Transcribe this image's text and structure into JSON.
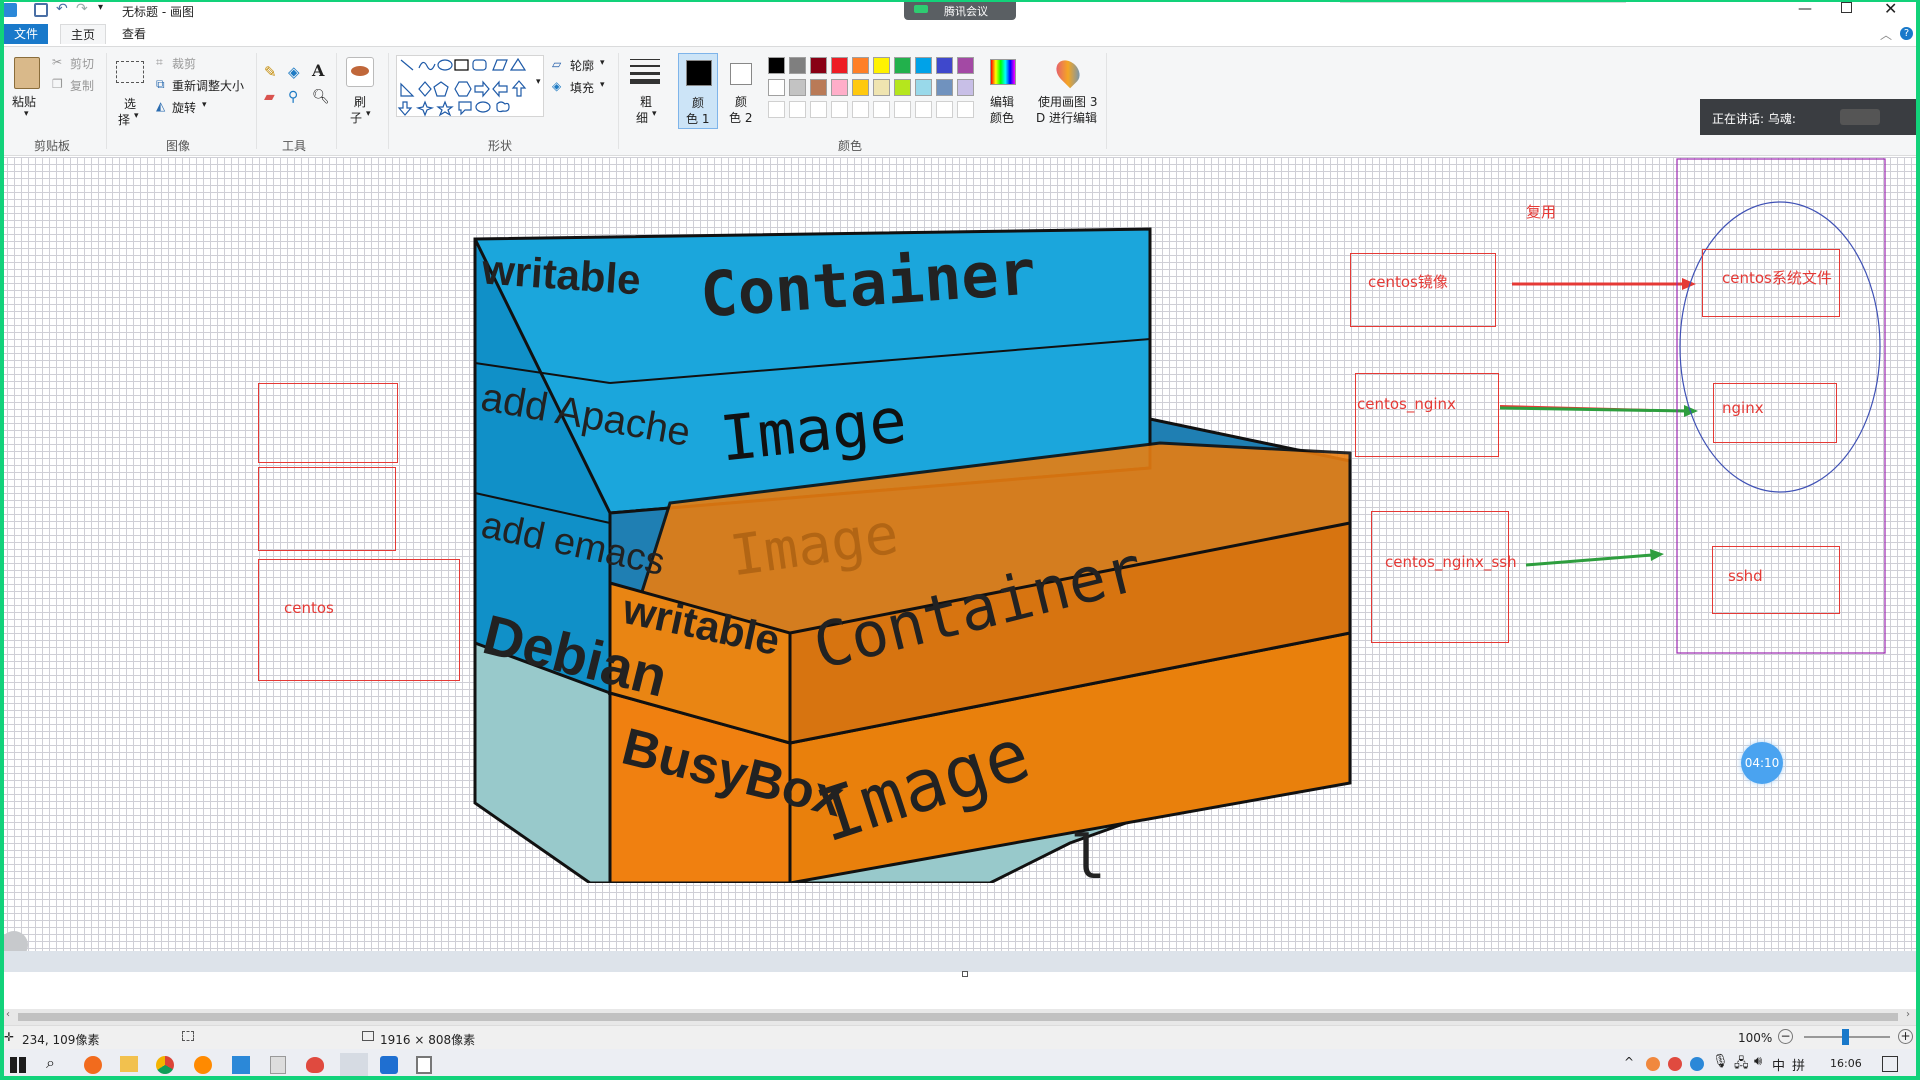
{
  "window": {
    "title": "无标题 - 画图",
    "meeting_label": "腾讯会议",
    "speaker": "正在讲话: 乌魂:"
  },
  "tabs": {
    "file": "文件",
    "home": "主页",
    "view": "查看"
  },
  "clipboard": {
    "paste": "粘贴",
    "cut": "剪切",
    "copy": "复制",
    "group": "剪贴板"
  },
  "image": {
    "select": "选",
    "select2": "择",
    "crop": "裁剪",
    "resize": "重新调整大小",
    "rotate": "旋转",
    "group": "图像"
  },
  "tools": {
    "group": "工具"
  },
  "brushes": {
    "label1": "刷",
    "label2": "子"
  },
  "shapes": {
    "outline": "轮廓",
    "fill": "填充",
    "group": "形状"
  },
  "size": {
    "label1": "粗",
    "label2": "细"
  },
  "colors": {
    "color1_a": "颜",
    "color1_b": "色 1",
    "color2_a": "颜",
    "color2_b": "色 2",
    "edit_a": "编辑",
    "edit_b": "颜色",
    "paint3d_a": "使用画图 3",
    "paint3d_b": "D 进行编辑",
    "group": "颜色",
    "palette_row1": [
      "#000000",
      "#7f7f7f",
      "#880015",
      "#ed1c24",
      "#ff7f27",
      "#fff200",
      "#22b14c",
      "#00a2e8",
      "#3f48cc",
      "#a349a4"
    ],
    "palette_row2": [
      "#ffffff",
      "#c3c3c3",
      "#b97a57",
      "#ffaec9",
      "#ffc90e",
      "#efe4b0",
      "#b5e61d",
      "#99d9ea",
      "#7092be",
      "#c8bfe7"
    ]
  },
  "canvas": {
    "diagram": {
      "writable": "writable",
      "container": "Container",
      "add_apache": "add Apache",
      "image": "Image",
      "add_emacs": "add emacs",
      "debian": "Debian",
      "image_ghost": "Image",
      "writable2": "writable",
      "container2": "Container",
      "busybox": "BusyBox",
      "image2": "Image",
      "kernel_fragment": "l"
    },
    "left_box_label": "centos",
    "reuse_label": "复用",
    "right_labels": [
      "centos镜像",
      "centos_nginx",
      "centos_nginx_ssh"
    ],
    "far_right_labels": [
      "centos系统文件",
      "nginx",
      "sshd"
    ],
    "timer": "04:10"
  },
  "status": {
    "cursor": "234, 109像素",
    "canvas_size": "1916 × 808像素",
    "zoom": "100%"
  },
  "taskbar": {
    "time": "16:06",
    "ime": "中",
    "ime2": "拼"
  }
}
